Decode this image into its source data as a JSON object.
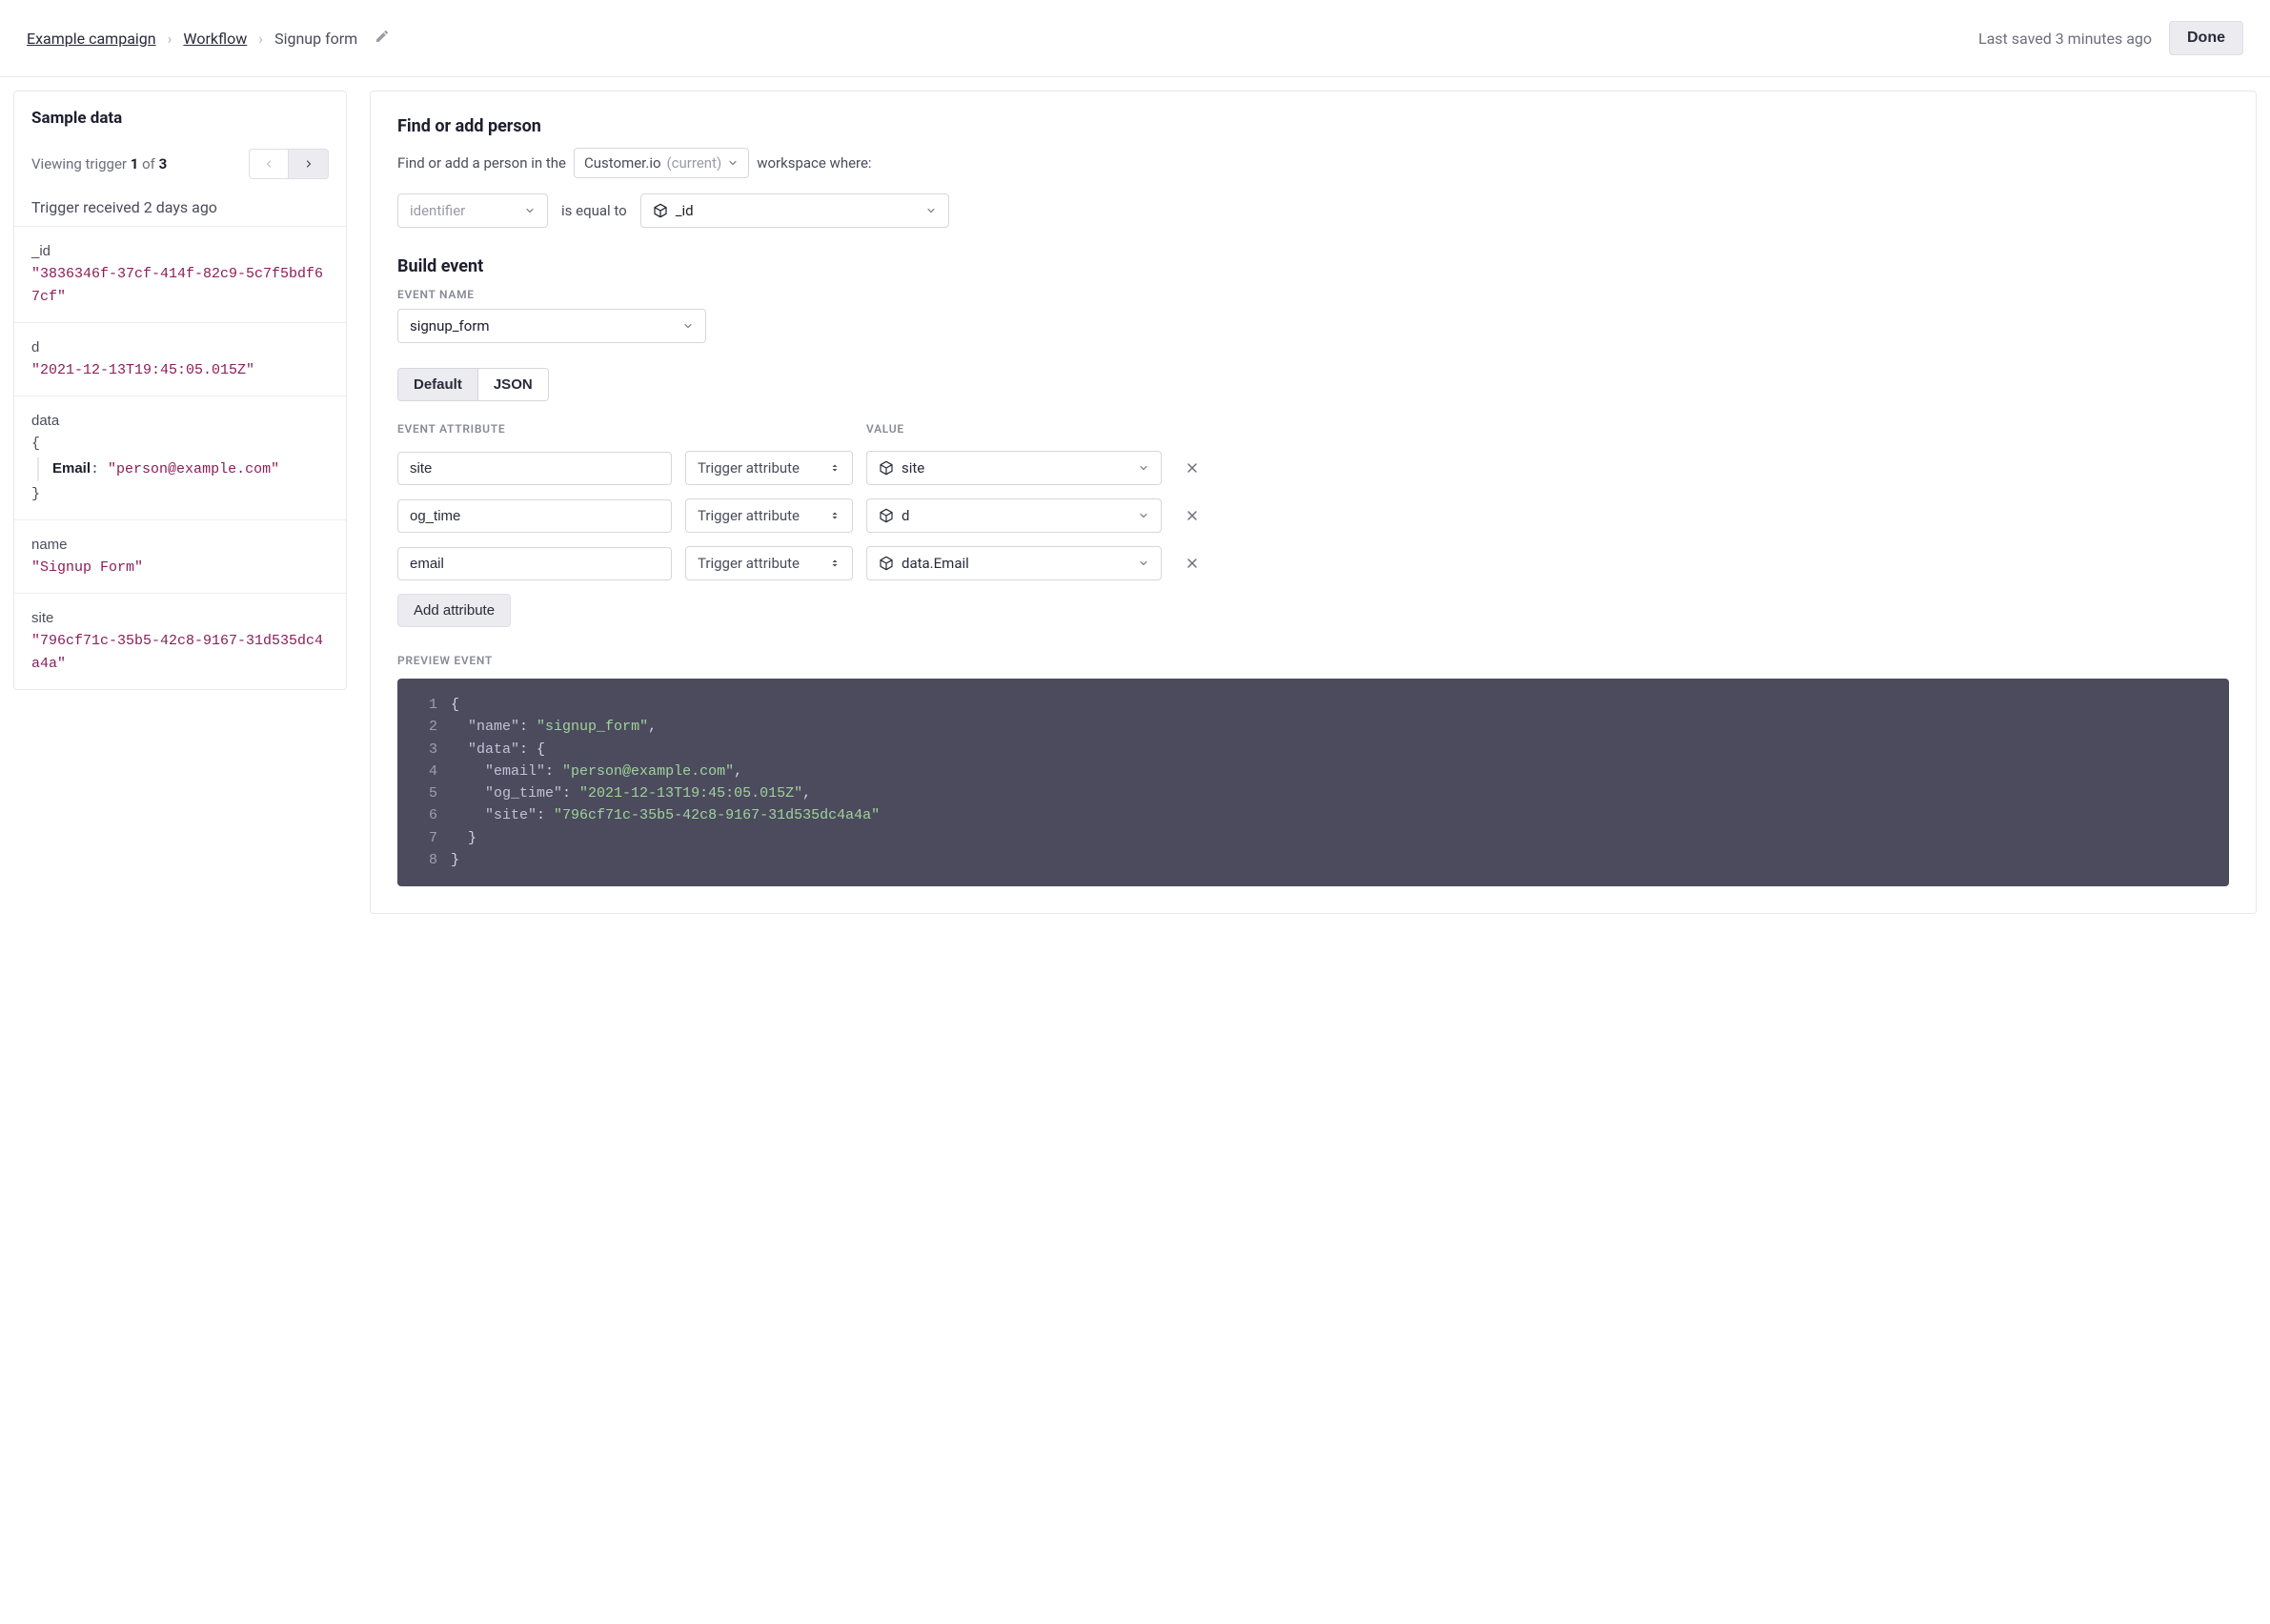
{
  "header": {
    "crumb1": "Example campaign",
    "crumb2": "Workflow",
    "current": "Signup form",
    "saved": "Last saved 3 minutes ago",
    "done": "Done"
  },
  "sidebar": {
    "title": "Sample data",
    "viewing_prefix": "Viewing trigger ",
    "viewing_current": "1",
    "viewing_of": " of ",
    "viewing_total": "3",
    "trigger_received": "Trigger received 2 days ago",
    "items": [
      {
        "key": "_id",
        "value": "\"3836346f-37cf-414f-82c9-5c7f5bdf67cf\""
      },
      {
        "key": "d",
        "value": "\"2021-12-13T19:45:05.015Z\""
      }
    ],
    "data_key": "data",
    "data_inner_key": "Email",
    "data_inner_val": "\"person@example.com\"",
    "items2": [
      {
        "key": "name",
        "value": "\"Signup Form\""
      },
      {
        "key": "site",
        "value": "\"796cf71c-35b5-42c8-9167-31d535dc4a4a\""
      }
    ]
  },
  "content": {
    "find_title": "Find or add person",
    "find_sub_pre": "Find or add a person in the",
    "workspace_name": "Customer.io",
    "workspace_suffix": "(current)",
    "find_sub_post": "workspace where:",
    "identifier_placeholder": "identifier",
    "equal_to": "is equal to",
    "id_field": "_id",
    "build_title": "Build event",
    "event_name_label": "Event name",
    "event_name_value": "signup_form",
    "tab_default": "Default",
    "tab_json": "JSON",
    "col_attr": "Event attribute",
    "col_value": "Value",
    "rows": [
      {
        "attr": "site",
        "type": "Trigger attribute",
        "value": "site"
      },
      {
        "attr": "og_time",
        "type": "Trigger attribute",
        "value": "d"
      },
      {
        "attr": "email",
        "type": "Trigger attribute",
        "value": "data.Email"
      }
    ],
    "add_attr": "Add attribute",
    "preview_label": "Preview event",
    "code": [
      {
        "n": "1",
        "t": "{"
      },
      {
        "n": "2",
        "t": "  \"name\": \"signup_form\","
      },
      {
        "n": "3",
        "t": "  \"data\": {"
      },
      {
        "n": "4",
        "t": "    \"email\": \"person@example.com\","
      },
      {
        "n": "5",
        "t": "    \"og_time\": \"2021-12-13T19:45:05.015Z\","
      },
      {
        "n": "6",
        "t": "    \"site\": \"796cf71c-35b5-42c8-9167-31d535dc4a4a\""
      },
      {
        "n": "7",
        "t": "  }"
      },
      {
        "n": "8",
        "t": "}"
      }
    ]
  }
}
